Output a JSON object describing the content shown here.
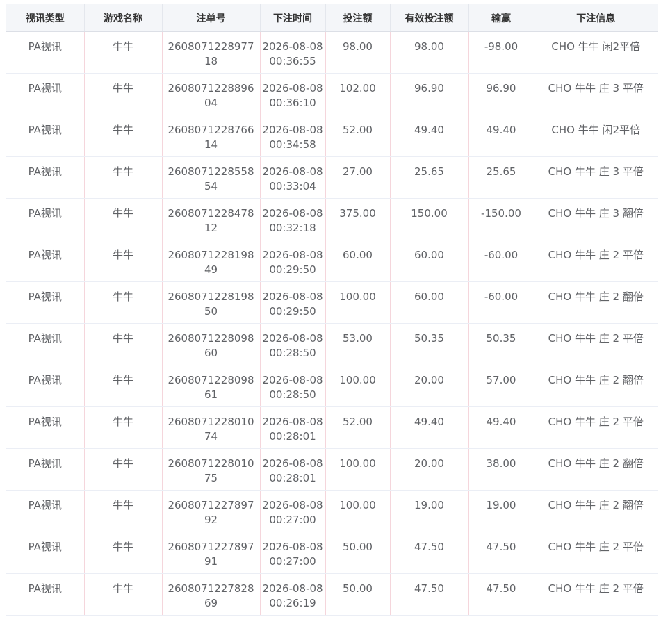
{
  "table": {
    "columns": [
      "视讯类型",
      "游戏名称",
      "注单号",
      "下注时间",
      "投注额",
      "有效投注额",
      "输赢",
      "下注信息"
    ],
    "rows": [
      [
        "PA视讯",
        "牛牛",
        "260807122897718",
        "2026-08-08 00:36:55",
        "98.00",
        "98.00",
        "-98.00",
        "CHO 牛牛 闲2平倍"
      ],
      [
        "PA视讯",
        "牛牛",
        "260807122889604",
        "2026-08-08 00:36:10",
        "102.00",
        "96.90",
        "96.90",
        "CHO 牛牛 庄 3 平倍"
      ],
      [
        "PA视讯",
        "牛牛",
        "260807122876614",
        "2026-08-08 00:34:58",
        "52.00",
        "49.40",
        "49.40",
        "CHO 牛牛 闲2平倍"
      ],
      [
        "PA视讯",
        "牛牛",
        "260807122855854",
        "2026-08-08 00:33:04",
        "27.00",
        "25.65",
        "25.65",
        "CHO 牛牛 庄 3 平倍"
      ],
      [
        "PA视讯",
        "牛牛",
        "260807122847812",
        "2026-08-08 00:32:18",
        "375.00",
        "150.00",
        "-150.00",
        "CHO 牛牛 庄 3 翻倍"
      ],
      [
        "PA视讯",
        "牛牛",
        "260807122819849",
        "2026-08-08 00:29:50",
        "60.00",
        "60.00",
        "-60.00",
        "CHO 牛牛 庄 2 平倍"
      ],
      [
        "PA视讯",
        "牛牛",
        "260807122819850",
        "2026-08-08 00:29:50",
        "100.00",
        "60.00",
        "-60.00",
        "CHO 牛牛 庄 2 翻倍"
      ],
      [
        "PA视讯",
        "牛牛",
        "260807122809860",
        "2026-08-08 00:28:50",
        "53.00",
        "50.35",
        "50.35",
        "CHO 牛牛 庄 2 平倍"
      ],
      [
        "PA视讯",
        "牛牛",
        "260807122809861",
        "2026-08-08 00:28:50",
        "100.00",
        "20.00",
        "57.00",
        "CHO 牛牛 庄 2 翻倍"
      ],
      [
        "PA视讯",
        "牛牛",
        "260807122801074",
        "2026-08-08 00:28:01",
        "52.00",
        "49.40",
        "49.40",
        "CHO 牛牛 庄 2 平倍"
      ],
      [
        "PA视讯",
        "牛牛",
        "260807122801075",
        "2026-08-08 00:28:01",
        "100.00",
        "20.00",
        "38.00",
        "CHO 牛牛 庄 2 翻倍"
      ],
      [
        "PA视讯",
        "牛牛",
        "260807122789792",
        "2026-08-08 00:27:00",
        "100.00",
        "19.00",
        "19.00",
        "CHO 牛牛 庄 2 翻倍"
      ],
      [
        "PA视讯",
        "牛牛",
        "260807122789791",
        "2026-08-08 00:27:00",
        "50.00",
        "47.50",
        "47.50",
        "CHO 牛牛 庄 2 平倍"
      ],
      [
        "PA视讯",
        "牛牛",
        "260807122782869",
        "2026-08-08 00:26:19",
        "50.00",
        "47.50",
        "47.50",
        "CHO 牛牛 庄 2 平倍"
      ]
    ]
  },
  "colors": {
    "header_bg": "#f4f6f9",
    "text": "#606266",
    "header_text": "#333333",
    "column_divider": "#f5d6dc"
  }
}
